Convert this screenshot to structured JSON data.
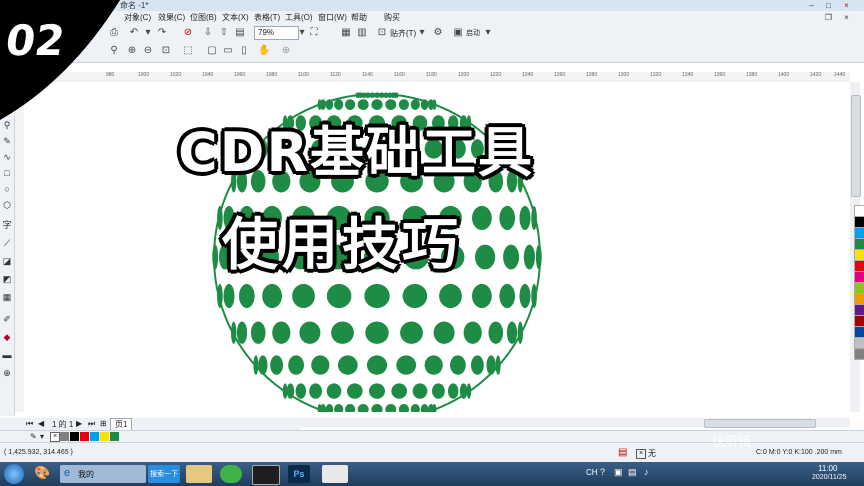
{
  "window": {
    "title": "命名 -1*"
  },
  "menu": {
    "items": [
      "对象(C)",
      "效果(C)",
      "位图(B)",
      "文本(X)",
      "表格(T)",
      "工具(O)",
      "窗口(W)",
      "帮助",
      "购买"
    ]
  },
  "toolbar": {
    "zoom": "79%",
    "snap_label": "贴齐(T)",
    "launch_label": "启动"
  },
  "ruler": {
    "h_ticks": [
      "980",
      "1000",
      "1020",
      "1040",
      "1060",
      "1080",
      "1100",
      "1120",
      "1140",
      "1160",
      "1180",
      "1200",
      "1220",
      "1240",
      "1260",
      "1280",
      "1300",
      "1320",
      "1340",
      "1360",
      "1380",
      "1400",
      "1420",
      "1440"
    ]
  },
  "pages": {
    "position": "1 的 1",
    "tab": "页1"
  },
  "status": {
    "coordinates": "( 1,425.932, 314.465 )",
    "fill_none": "无",
    "outline_info": "C:0 M:0 Y:0 K:100  .200 mm"
  },
  "taskbar": {
    "search_label": "搜索一下",
    "ie_label": "我的",
    "ime": "CH",
    "time": "11:00",
    "date": "2020/11/25"
  },
  "overlay": {
    "episode": "02",
    "title": "CDR基础工具",
    "subtitle": "使用技巧",
    "watermark": "快剪辑"
  },
  "colors": {
    "dot_green": "#1e8c45",
    "accent_black": "#000000"
  },
  "palette": [
    "#ffffff",
    "#000000",
    "#00a0e9",
    "#1e8c45",
    "#ffe100",
    "#e60012",
    "#e4007f",
    "#8fc31f",
    "#f39800",
    "#601986",
    "#a40000",
    "#00479d",
    "#c0c0c0",
    "#808080"
  ],
  "doc_palette": [
    "#808080",
    "#000000",
    "#e60012",
    "#00a0e9",
    "#ffe100",
    "#1e8c45"
  ]
}
